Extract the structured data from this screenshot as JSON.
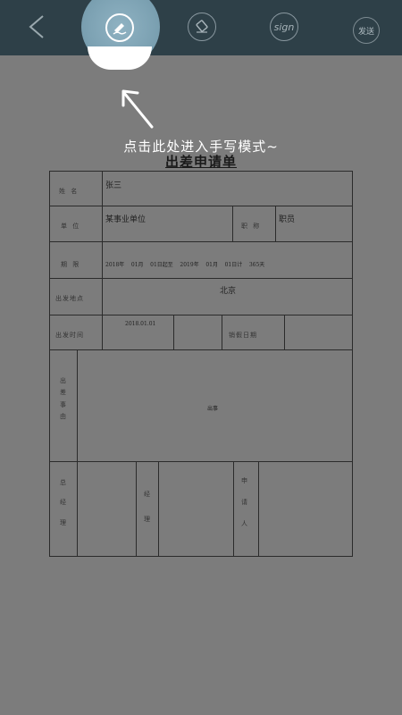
{
  "toolbar": {
    "back_icon": "back-arrow-icon",
    "handwrite_icon": "handwriting-pen-icon",
    "eraser_icon": "eraser-icon",
    "sign_label": "sign",
    "send_label": "发送"
  },
  "hint_text": "点击此处进入手写模式~",
  "document": {
    "title": "出差申请单",
    "name_label": "姓  名",
    "name_value": "张三",
    "unit_label": "单  位",
    "unit_value": "某事业单位",
    "position_label": "职  称",
    "position_value": "职员",
    "period_label": "期  限",
    "period_text": "2018年    01月    01日起至    2019年    01月    01日计    365天",
    "destination_label": "出发地点",
    "destination_value": "北京",
    "depart_time_label": "出发时间",
    "depart_time_value": "2018.01.01",
    "arrival_label": "销假日期",
    "reason_label": "出差事由",
    "reason_value": "出事",
    "manager_label": "总经理",
    "supervisor_label": "经理",
    "applicant_label": "申请人"
  },
  "colors": {
    "toolbar_bg": "#2e4048",
    "overlay_bg": "#7c7c7c",
    "highlight": "#8fb2c2"
  }
}
